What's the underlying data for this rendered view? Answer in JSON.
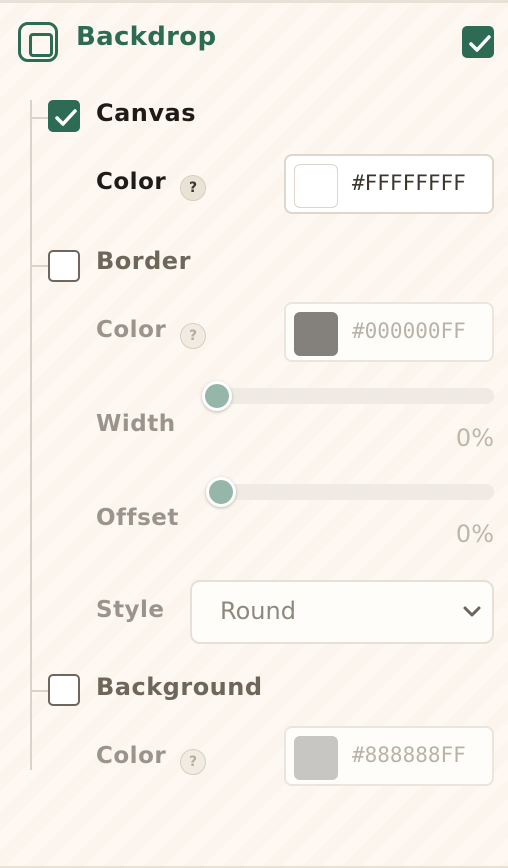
{
  "panel": {
    "title": "Backdrop",
    "enabled": true
  },
  "canvas": {
    "label": "Canvas",
    "checked": true,
    "color_label": "Color",
    "help": "?",
    "color_value": "#FFFFFFFF",
    "swatch": "#ffffff"
  },
  "border": {
    "label": "Border",
    "checked": false,
    "color_label": "Color",
    "help": "?",
    "color_value": "#000000FF",
    "swatch": "#84807b",
    "width_label": "Width",
    "width_value": "0%",
    "offset_label": "Offset",
    "offset_value": "0%",
    "style_label": "Style",
    "style_value": "Round"
  },
  "background": {
    "label": "Background",
    "checked": false,
    "color_label": "Color",
    "help": "?",
    "color_value": "#888888FF",
    "swatch": "#c8c6c2"
  },
  "colors": {
    "accent": "#2e6b55",
    "panel_bg": "#fdf8f1"
  },
  "icons": {
    "panel": "square-frame-icon",
    "check": "checkmark-icon",
    "dropdown": "chevron-down-icon",
    "help": "help-icon"
  }
}
